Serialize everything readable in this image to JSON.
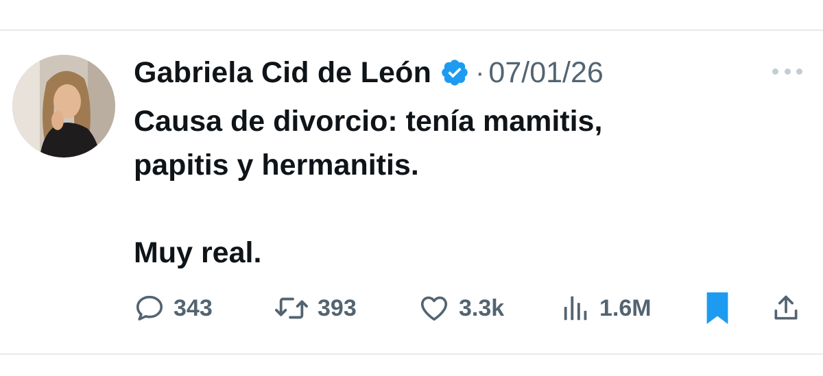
{
  "tweet": {
    "author_name": "Gabriela Cid de León",
    "separator": "·",
    "date": "07/01/26",
    "text_line_1": "Causa de divorcio: tenía mamitis,",
    "text_line_2": "papitis y hermanitis.",
    "text_line_3": "Muy real."
  },
  "actions": {
    "replies": "343",
    "retweets": "393",
    "likes": "3.3k",
    "views": "1.6M"
  },
  "icons": {
    "verified": "verified-badge-icon",
    "more": "more-options-icon",
    "reply": "reply-icon",
    "retweet": "retweet-icon",
    "like": "heart-icon",
    "views": "views-chart-icon",
    "bookmark": "bookmark-icon",
    "share": "share-icon"
  },
  "colors": {
    "text": "#0f1419",
    "secondary": "#536471",
    "verified_blue": "#1d9bf0",
    "divider": "#e6e9ec"
  }
}
